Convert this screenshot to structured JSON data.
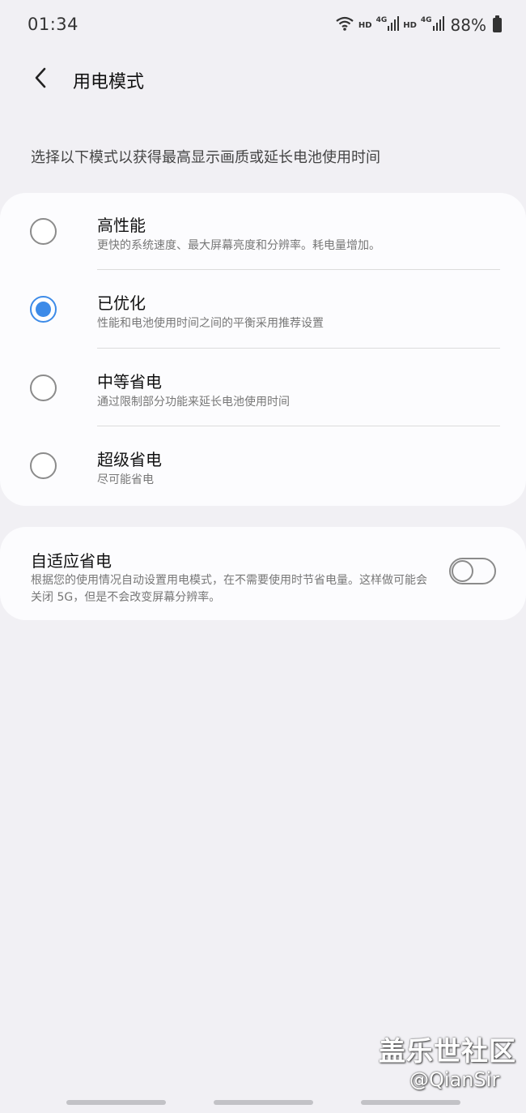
{
  "status_bar": {
    "time": "01:34",
    "hd_1": "HD",
    "net_1": "4G",
    "hd_2": "HD",
    "net_2": "4G",
    "battery": "88%"
  },
  "header": {
    "title": "用电模式"
  },
  "description": "选择以下模式以获得最高显示画质或延长电池使用时间",
  "modes": [
    {
      "title": "高性能",
      "subtitle": "更快的系统速度、最大屏幕亮度和分辨率。耗电量增加。",
      "selected": false
    },
    {
      "title": "已优化",
      "subtitle": "性能和电池使用时间之间的平衡采用推荐设置",
      "selected": true
    },
    {
      "title": "中等省电",
      "subtitle": "通过限制部分功能来延长电池使用时间",
      "selected": false
    },
    {
      "title": "超级省电",
      "subtitle": "尽可能省电",
      "selected": false
    }
  ],
  "adaptive": {
    "title": "自适应省电",
    "subtitle": "根据您的使用情况自动设置用电模式，在不需要使用时节省电量。这样做可能会关闭 5G，但是不会改变屏幕分辨率。",
    "enabled": false
  },
  "watermark": {
    "main": "盖乐世社区",
    "sub": "@QianSir"
  },
  "colors": {
    "accent": "#3d8be8",
    "background": "#f1f0f4",
    "card": "#fcfcfe"
  }
}
